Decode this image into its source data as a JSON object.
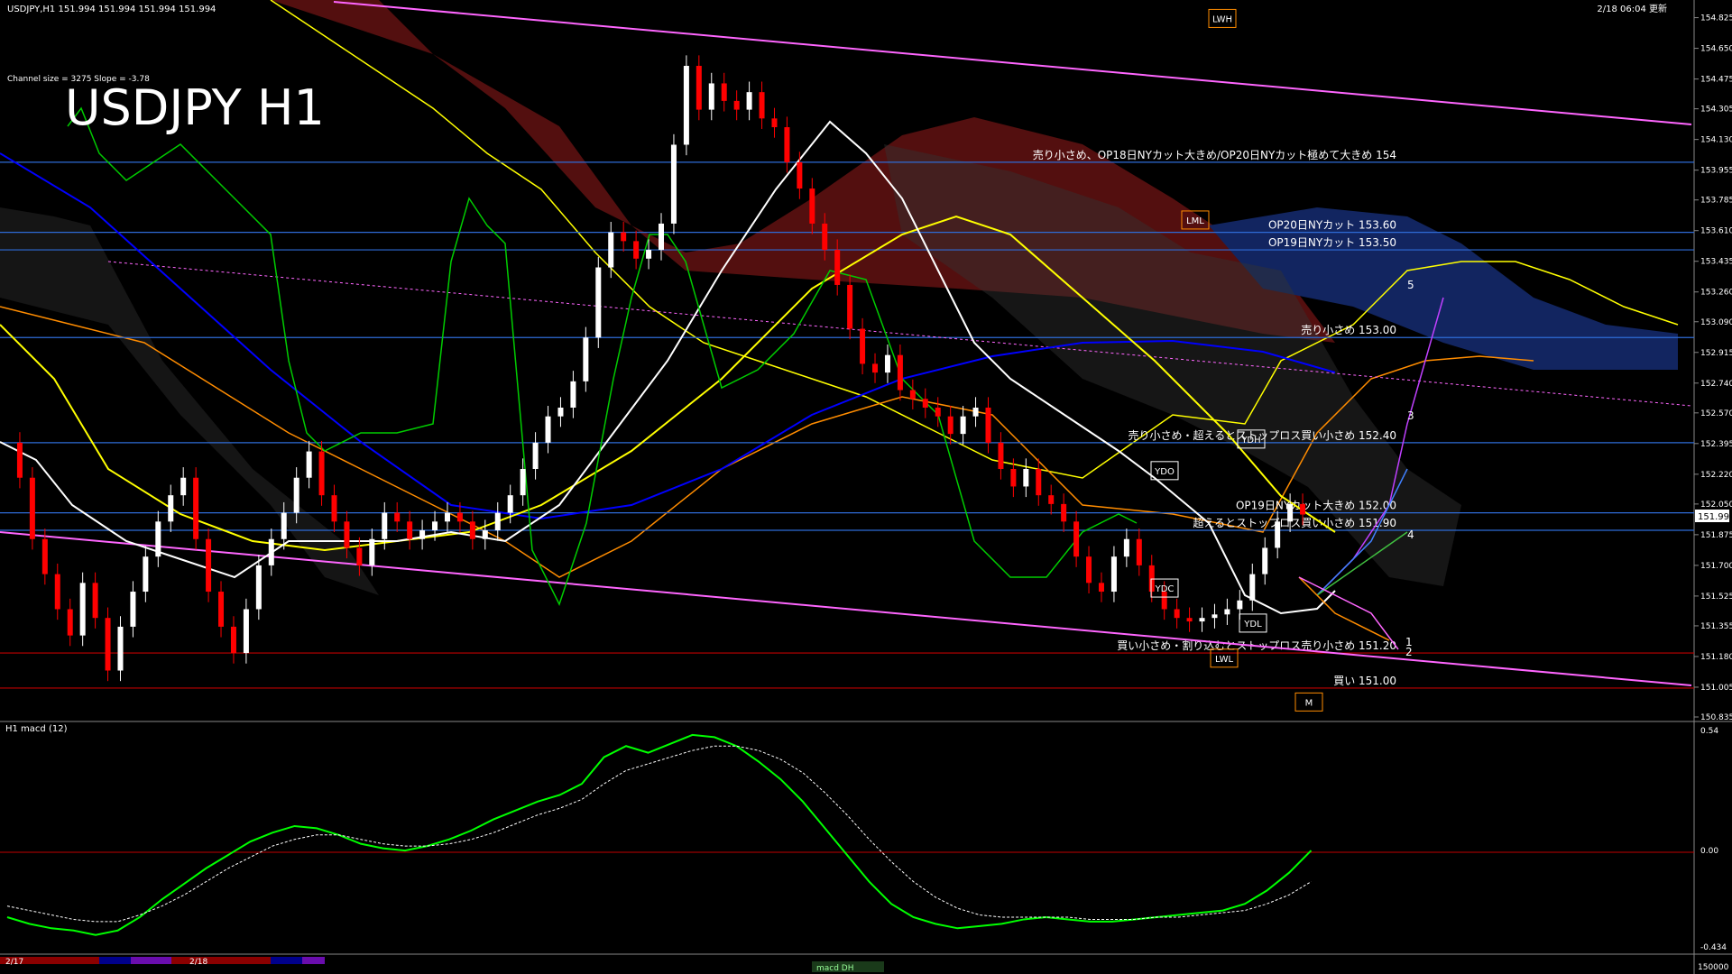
{
  "header": {
    "symbol_info": "USDJPY,H1  151.994 151.994 151.994 151.994",
    "datetime": "2/18 06:04 更新",
    "channel_info": "Channel size = 3275 Slope = -3.78",
    "big_title": "USDJPY H1"
  },
  "colors": {
    "background": "#000000",
    "bull_candle": "#ffffff",
    "bear_candle": "#ff0000",
    "resistance_line": "#2e6bd6",
    "support_line": "#c00000",
    "channel": "#ff66ff",
    "ma_fast": "#ffffff",
    "ma_mid": "#ffff00",
    "ma_slow": "#0000ff",
    "cloud_upper": "#ffff00",
    "cloud_lower": "#ff8c00",
    "chikou": "#00ff00",
    "macd_up": "#00ff00",
    "macd_down": "#ff6699",
    "signal": "#ffffff"
  },
  "chart_data": [
    {
      "type": "line",
      "name": "price",
      "y_axis_ticks": [
        "154.825",
        "154.650",
        "154.475",
        "154.305",
        "154.130",
        "153.955",
        "153.785",
        "153.610",
        "153.435",
        "153.260",
        "153.090",
        "152.915",
        "152.740",
        "152.570",
        "152.395",
        "152.220",
        "152.050",
        "151.875",
        "151.700",
        "151.525",
        "151.355",
        "151.180",
        "151.005",
        "150.835"
      ],
      "ylim": [
        150.835,
        154.9
      ],
      "current_price": "151.994",
      "x_ticks": [
        "2/17",
        "2/18"
      ],
      "price_points": [
        152.4,
        152.2,
        151.85,
        151.65,
        151.45,
        151.3,
        151.6,
        151.4,
        151.1,
        151.35,
        151.55,
        151.75,
        151.95,
        152.1,
        152.2,
        151.85,
        151.55,
        151.35,
        151.2,
        151.45,
        151.7,
        151.85,
        152.0,
        152.2,
        152.35,
        152.1,
        151.95,
        151.8,
        151.7,
        151.85,
        152.0,
        151.95,
        151.85,
        151.9,
        151.95,
        152.0,
        151.95,
        151.85,
        151.9,
        152.0,
        152.1,
        152.25,
        152.4,
        152.55,
        152.6,
        152.75,
        153.0,
        153.4,
        153.6,
        153.55,
        153.45,
        153.5,
        153.65,
        154.1,
        154.55,
        154.3,
        154.45,
        154.35,
        154.3,
        154.4,
        154.25,
        154.2,
        154.0,
        153.85,
        153.65,
        153.5,
        153.3,
        153.05,
        152.85,
        152.8,
        152.9,
        152.7,
        152.65,
        152.6,
        152.55,
        152.45,
        152.55,
        152.6,
        152.4,
        152.25,
        152.15,
        152.25,
        152.1,
        152.05,
        151.95,
        151.75,
        151.6,
        151.55,
        151.75,
        151.85,
        151.7,
        151.55,
        151.45,
        151.4,
        151.38,
        151.4,
        151.42,
        151.45,
        151.5,
        151.65,
        151.8,
        151.95,
        152.05,
        151.99
      ],
      "horizontal_levels": [
        {
          "price": 154.0,
          "label": "売り小さめ、OP18日NYカット大きめ/OP20日NYカット極めて大きめ 154",
          "color": "#2e6bd6"
        },
        {
          "price": 153.6,
          "label": "OP20日NYカット 153.60",
          "color": "#2e6bd6"
        },
        {
          "price": 153.5,
          "label": "OP19日NYカット 153.50",
          "color": "#2e6bd6"
        },
        {
          "price": 153.0,
          "label": "売り小さめ 153.00",
          "color": "#2e6bd6"
        },
        {
          "price": 152.4,
          "label": "売り小さめ・超えるとストップロス買い小さめ 152.40",
          "color": "#2e6bd6"
        },
        {
          "price": 152.0,
          "label": "OP19日NYカット大きめ 152.00",
          "color": "#2e6bd6"
        },
        {
          "price": 151.9,
          "label": "超えるとストップロス買い小さめ 151.90",
          "color": "#2e6bd6"
        },
        {
          "price": 151.2,
          "label": "買い小さめ・割り込むとストップロス売り小さめ 151.20",
          "color": "#c00000"
        },
        {
          "price": 151.0,
          "label": "買い 151.00",
          "color": "#c00000"
        }
      ],
      "markers": [
        {
          "label": "LWH",
          "price": 154.8
        },
        {
          "label": "LML",
          "price": 153.65
        },
        {
          "label": "YDO",
          "price": 152.22
        },
        {
          "label": "YDH",
          "price": 152.4
        },
        {
          "label": "YDC",
          "price": 151.55
        },
        {
          "label": "YDL",
          "price": 151.35
        },
        {
          "label": "LWL",
          "price": 151.15
        },
        {
          "label": "M",
          "price": 150.9
        }
      ],
      "wave_labels": [
        "5",
        "3",
        "4",
        "1",
        "2"
      ]
    },
    {
      "type": "line",
      "name": "macd",
      "title": "H1  macd (12)",
      "y_axis_ticks": [
        "0.54",
        "0.00",
        "-0.434"
      ],
      "ylim": [
        -0.434,
        0.54
      ],
      "macd": [
        -0.3,
        -0.33,
        -0.35,
        -0.36,
        -0.38,
        -0.36,
        -0.3,
        -0.22,
        -0.15,
        -0.08,
        -0.02,
        0.04,
        0.08,
        0.11,
        0.1,
        0.07,
        0.03,
        0.01,
        0.0,
        0.02,
        0.05,
        0.09,
        0.14,
        0.18,
        0.22,
        0.25,
        0.3,
        0.42,
        0.47,
        0.44,
        0.48,
        0.52,
        0.51,
        0.47,
        0.4,
        0.32,
        0.22,
        0.1,
        -0.02,
        -0.14,
        -0.24,
        -0.3,
        -0.33,
        -0.35,
        -0.34,
        -0.33,
        -0.31,
        -0.3,
        -0.31,
        -0.32,
        -0.32,
        -0.31,
        -0.3,
        -0.29,
        -0.28,
        -0.27,
        -0.24,
        -0.18,
        -0.1,
        0.0
      ],
      "signal": [
        -0.25,
        -0.27,
        -0.29,
        -0.31,
        -0.32,
        -0.32,
        -0.29,
        -0.25,
        -0.2,
        -0.14,
        -0.08,
        -0.03,
        0.02,
        0.05,
        0.07,
        0.07,
        0.05,
        0.03,
        0.02,
        0.02,
        0.03,
        0.05,
        0.08,
        0.12,
        0.16,
        0.19,
        0.23,
        0.3,
        0.36,
        0.39,
        0.42,
        0.45,
        0.47,
        0.47,
        0.45,
        0.41,
        0.35,
        0.26,
        0.16,
        0.05,
        -0.05,
        -0.14,
        -0.21,
        -0.26,
        -0.29,
        -0.3,
        -0.3,
        -0.3,
        -0.3,
        -0.31,
        -0.31,
        -0.31,
        -0.3,
        -0.3,
        -0.29,
        -0.28,
        -0.27,
        -0.24,
        -0.2,
        -0.14
      ],
      "bottom_scale_label": "150000",
      "bottom_note": "macd DH"
    }
  ]
}
